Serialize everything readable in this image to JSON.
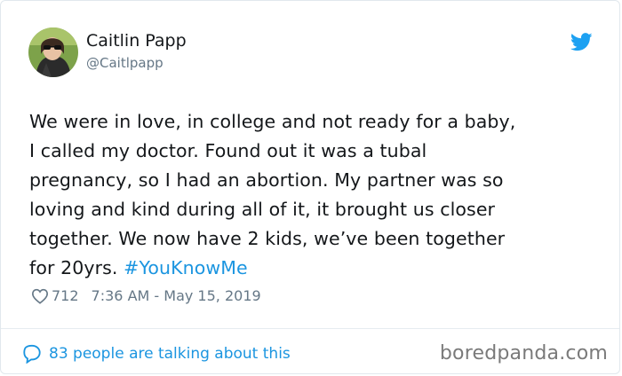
{
  "tweet": {
    "author": {
      "display_name": "Caitlin Papp",
      "handle": "@Caitlpapp",
      "avatar": "user-avatar-photo"
    },
    "platform_icon": "twitter-bird-icon",
    "text": "We were in love, in college and not ready for a baby,\nI called my doctor. Found out it was a tubal\npregnancy, so I had an abortion. My partner was so\nloving and kind during all of it, it brought us closer\ntogether. We now have 2 kids, we’ve been together\nfor 20yrs. ",
    "hashtag": "#YouKnowMe",
    "likes": "712",
    "timestamp": "7:36 AM - May 15, 2019",
    "talking_about": "83 people are talking about this"
  },
  "watermark": "boredpanda.com",
  "colors": {
    "link_blue": "#1b95e0",
    "twitter_blue": "#1da1f2",
    "muted_gray": "#657786"
  }
}
